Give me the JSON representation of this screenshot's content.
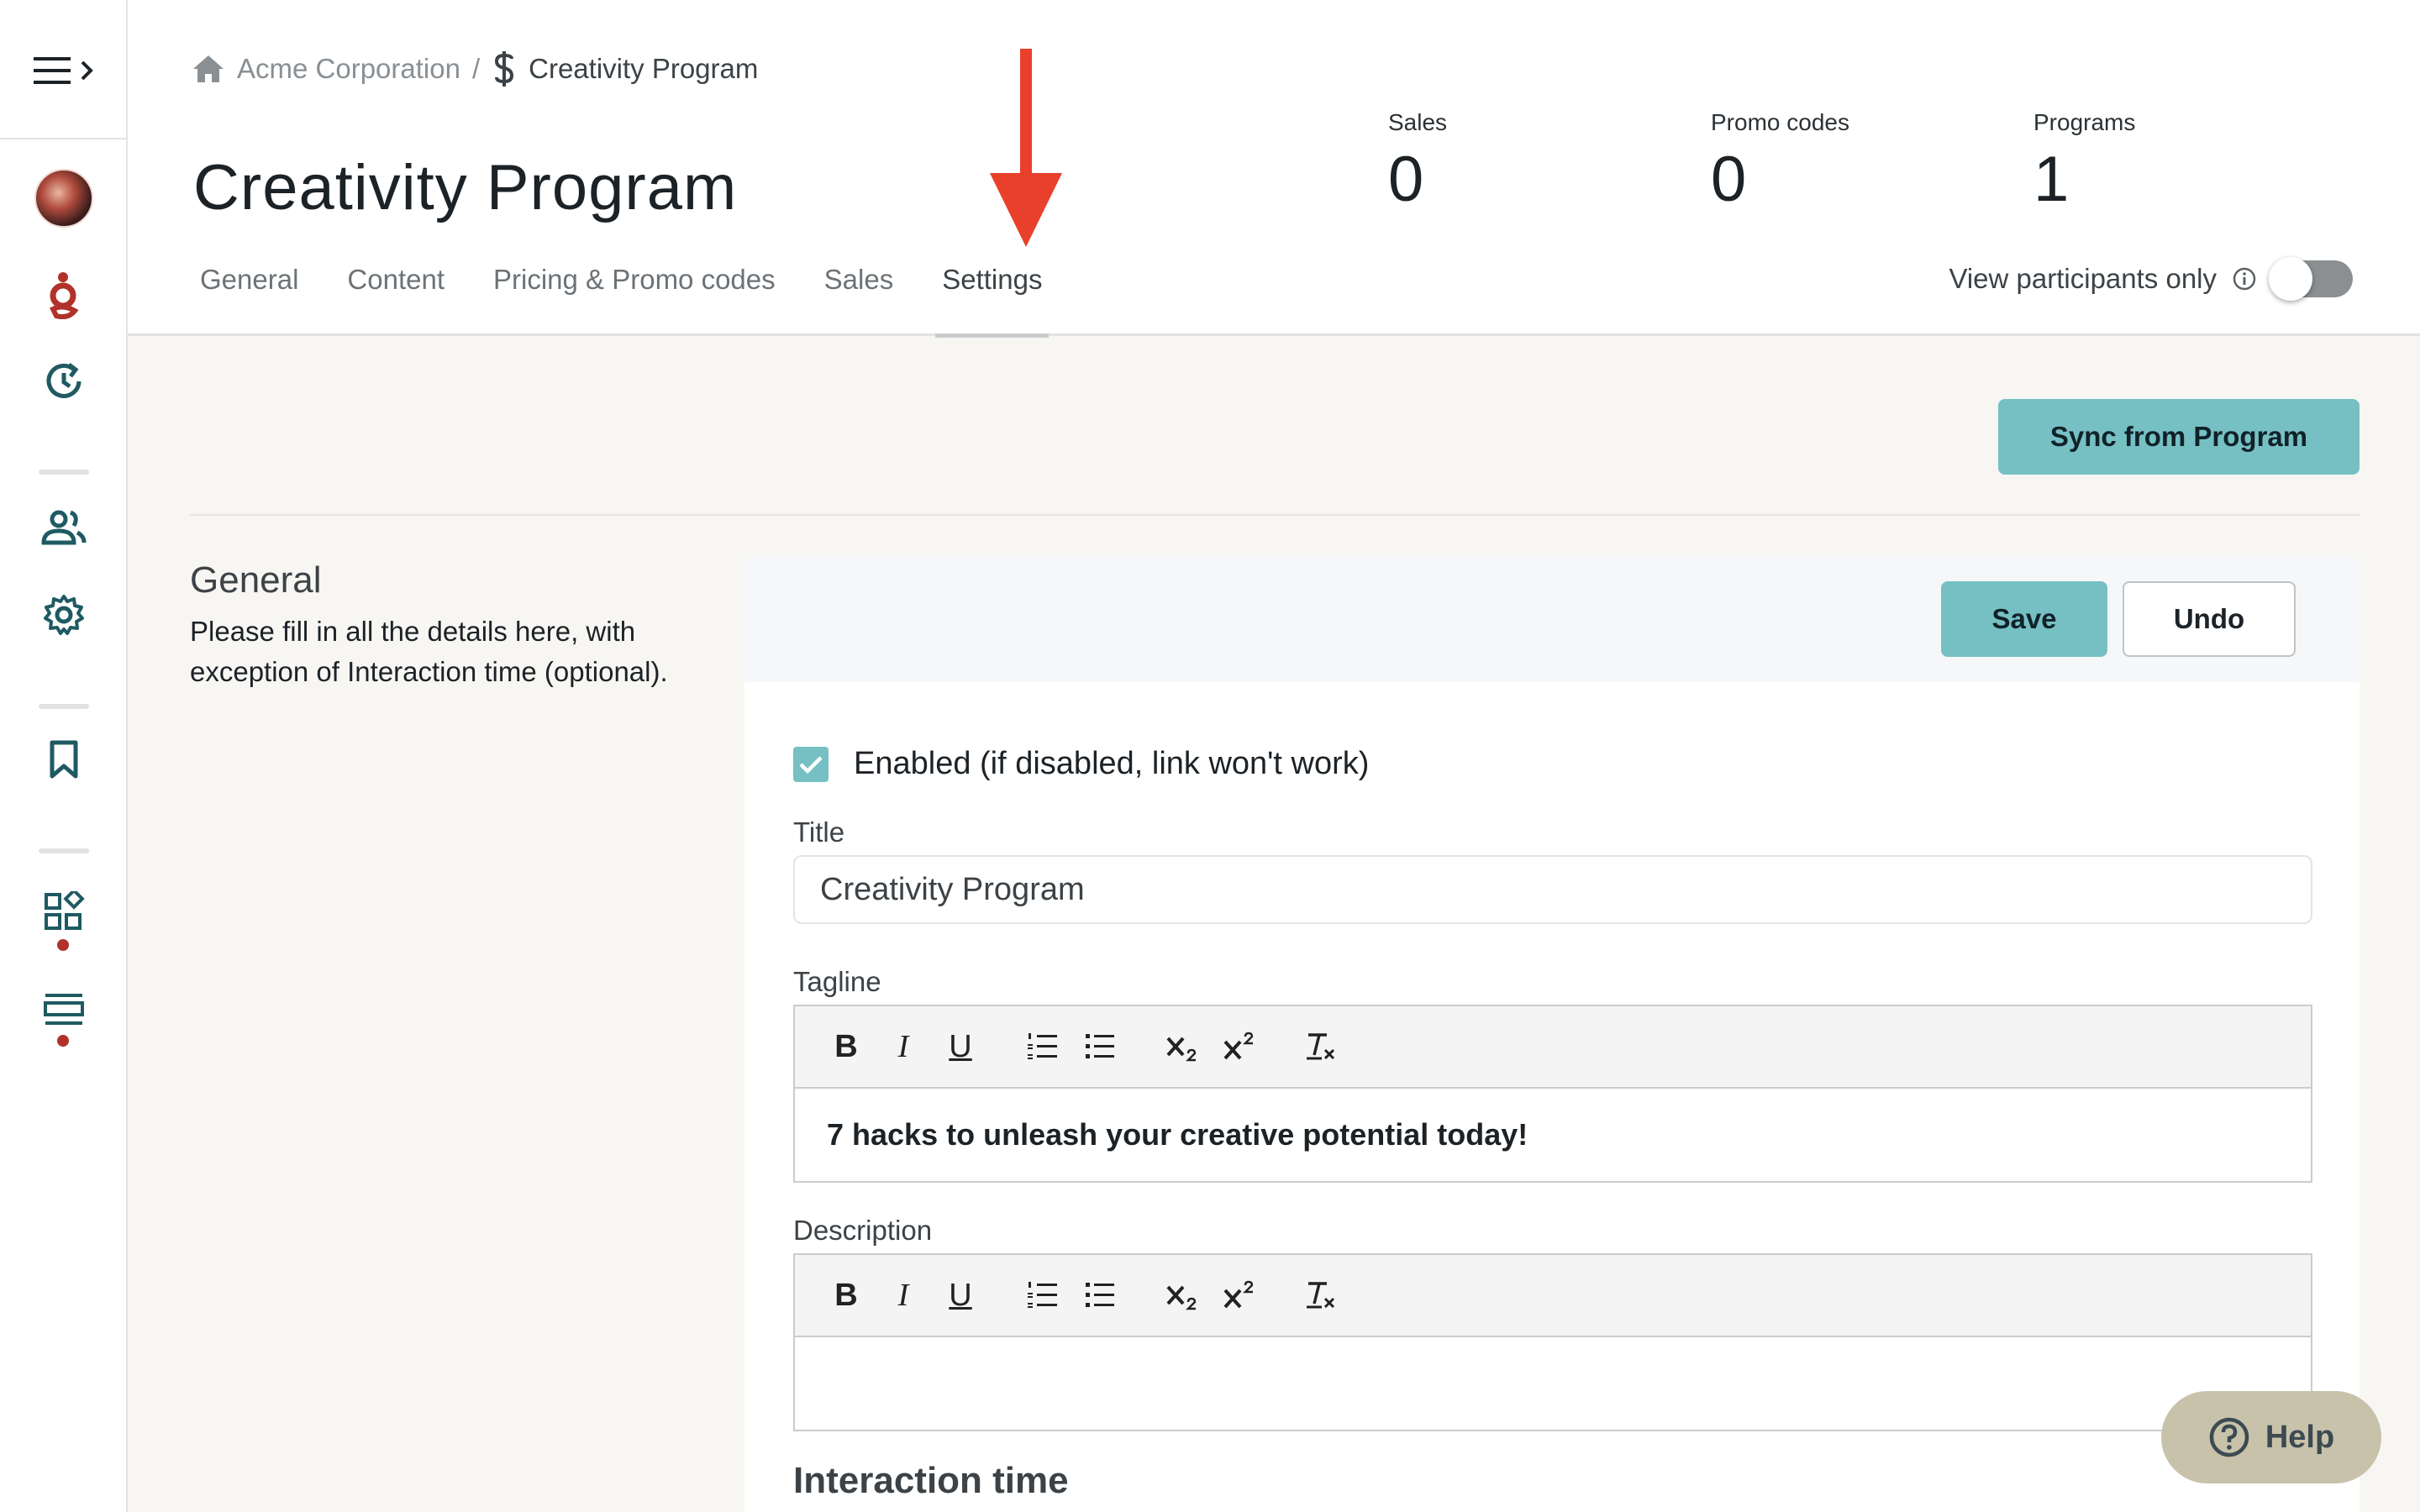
{
  "breadcrumb": {
    "org": "Acme Corporation",
    "separator": "/",
    "current": "Creativity Program"
  },
  "page": {
    "title": "Creativity Program"
  },
  "tabs": [
    {
      "label": "General"
    },
    {
      "label": "Content"
    },
    {
      "label": "Pricing & Promo codes"
    },
    {
      "label": "Sales"
    },
    {
      "label": "Settings",
      "active": true
    }
  ],
  "stats": [
    {
      "label": "Sales",
      "value": "0"
    },
    {
      "label": "Promo codes",
      "value": "0"
    },
    {
      "label": "Programs",
      "value": "1"
    }
  ],
  "view_participants": {
    "label": "View participants only",
    "enabled": false
  },
  "actions": {
    "sync_label": "Sync from Program",
    "save_label": "Save",
    "undo_label": "Undo",
    "help_label": "Help"
  },
  "general": {
    "title": "General",
    "description": "Please fill in all the details here, with exception of Interaction time (optional).",
    "enabled_label": "Enabled (if disabled, link won't work)",
    "enabled_checked": true,
    "title_label": "Title",
    "title_value": "Creativity Program",
    "tagline_label": "Tagline",
    "tagline_value": "7 hacks to unleash your creative potential today!",
    "description_label": "Description",
    "description_value": "",
    "interaction_time_label": "Interaction time"
  },
  "toolbar_buttons": {
    "bold": "B",
    "italic": "I",
    "underline": "U"
  },
  "colors": {
    "accent": "#76c0c4",
    "annotation_arrow": "#e8402a",
    "brand_g": "#b0322a",
    "sidebar_icon": "#1f5a62",
    "help_bg": "#c8c2aa"
  },
  "icons": {
    "home": "home-icon",
    "dollar": "dollar-icon",
    "hamburger": "hamburger-icon",
    "history": "history-icon",
    "users": "users-icon",
    "settings": "gear-icon",
    "bookmark": "bookmark-icon",
    "apps": "apps-icon",
    "list": "list-icon",
    "info": "info-icon",
    "help": "question-icon"
  }
}
